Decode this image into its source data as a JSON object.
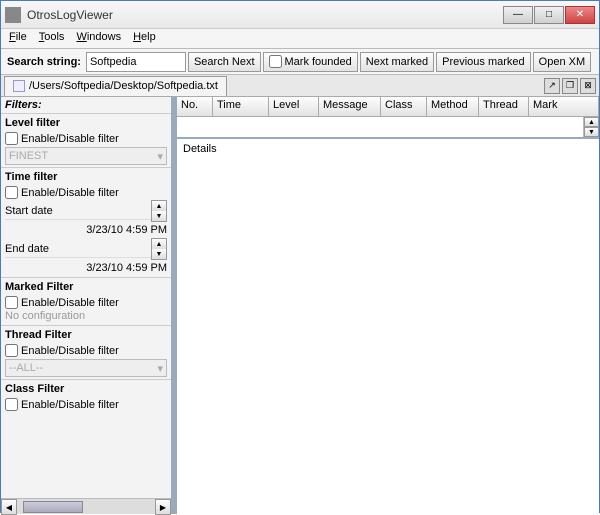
{
  "window": {
    "title": "OtrosLogViewer"
  },
  "menu": {
    "items": [
      "File",
      "Tools",
      "Windows",
      "Help"
    ]
  },
  "toolbar": {
    "search_label": "Search string:",
    "search_value": "Softpedia",
    "search_next": "Search Next",
    "mark_founded": "Mark founded",
    "next_marked": "Next marked",
    "prev_marked": "Previous marked",
    "open_xml": "Open XM"
  },
  "tab": {
    "path": "/Users/Softpedia/Desktop/Softpedia.txt"
  },
  "filters": {
    "header": "Filters:",
    "level": {
      "title": "Level filter",
      "enable_label": "Enable/Disable filter",
      "select": "FINEST"
    },
    "time": {
      "title": "Time filter",
      "enable_label": "Enable/Disable filter",
      "start_label": "Start date",
      "start_value": "3/23/10 4:59 PM",
      "end_label": "End date",
      "end_value": "3/23/10 4:59 PM"
    },
    "marked": {
      "title": "Marked Filter",
      "enable_label": "Enable/Disable filter",
      "noconf": "No configuration"
    },
    "thread": {
      "title": "Thread Filter",
      "enable_label": "Enable/Disable filter",
      "select": "--ALL--"
    },
    "class": {
      "title": "Class Filter",
      "enable_label": "Enable/Disable filter"
    }
  },
  "table": {
    "columns": [
      "No.",
      "Time",
      "Level",
      "Message",
      "Class",
      "Method",
      "Thread",
      "Mark"
    ],
    "details_label": "Details"
  }
}
